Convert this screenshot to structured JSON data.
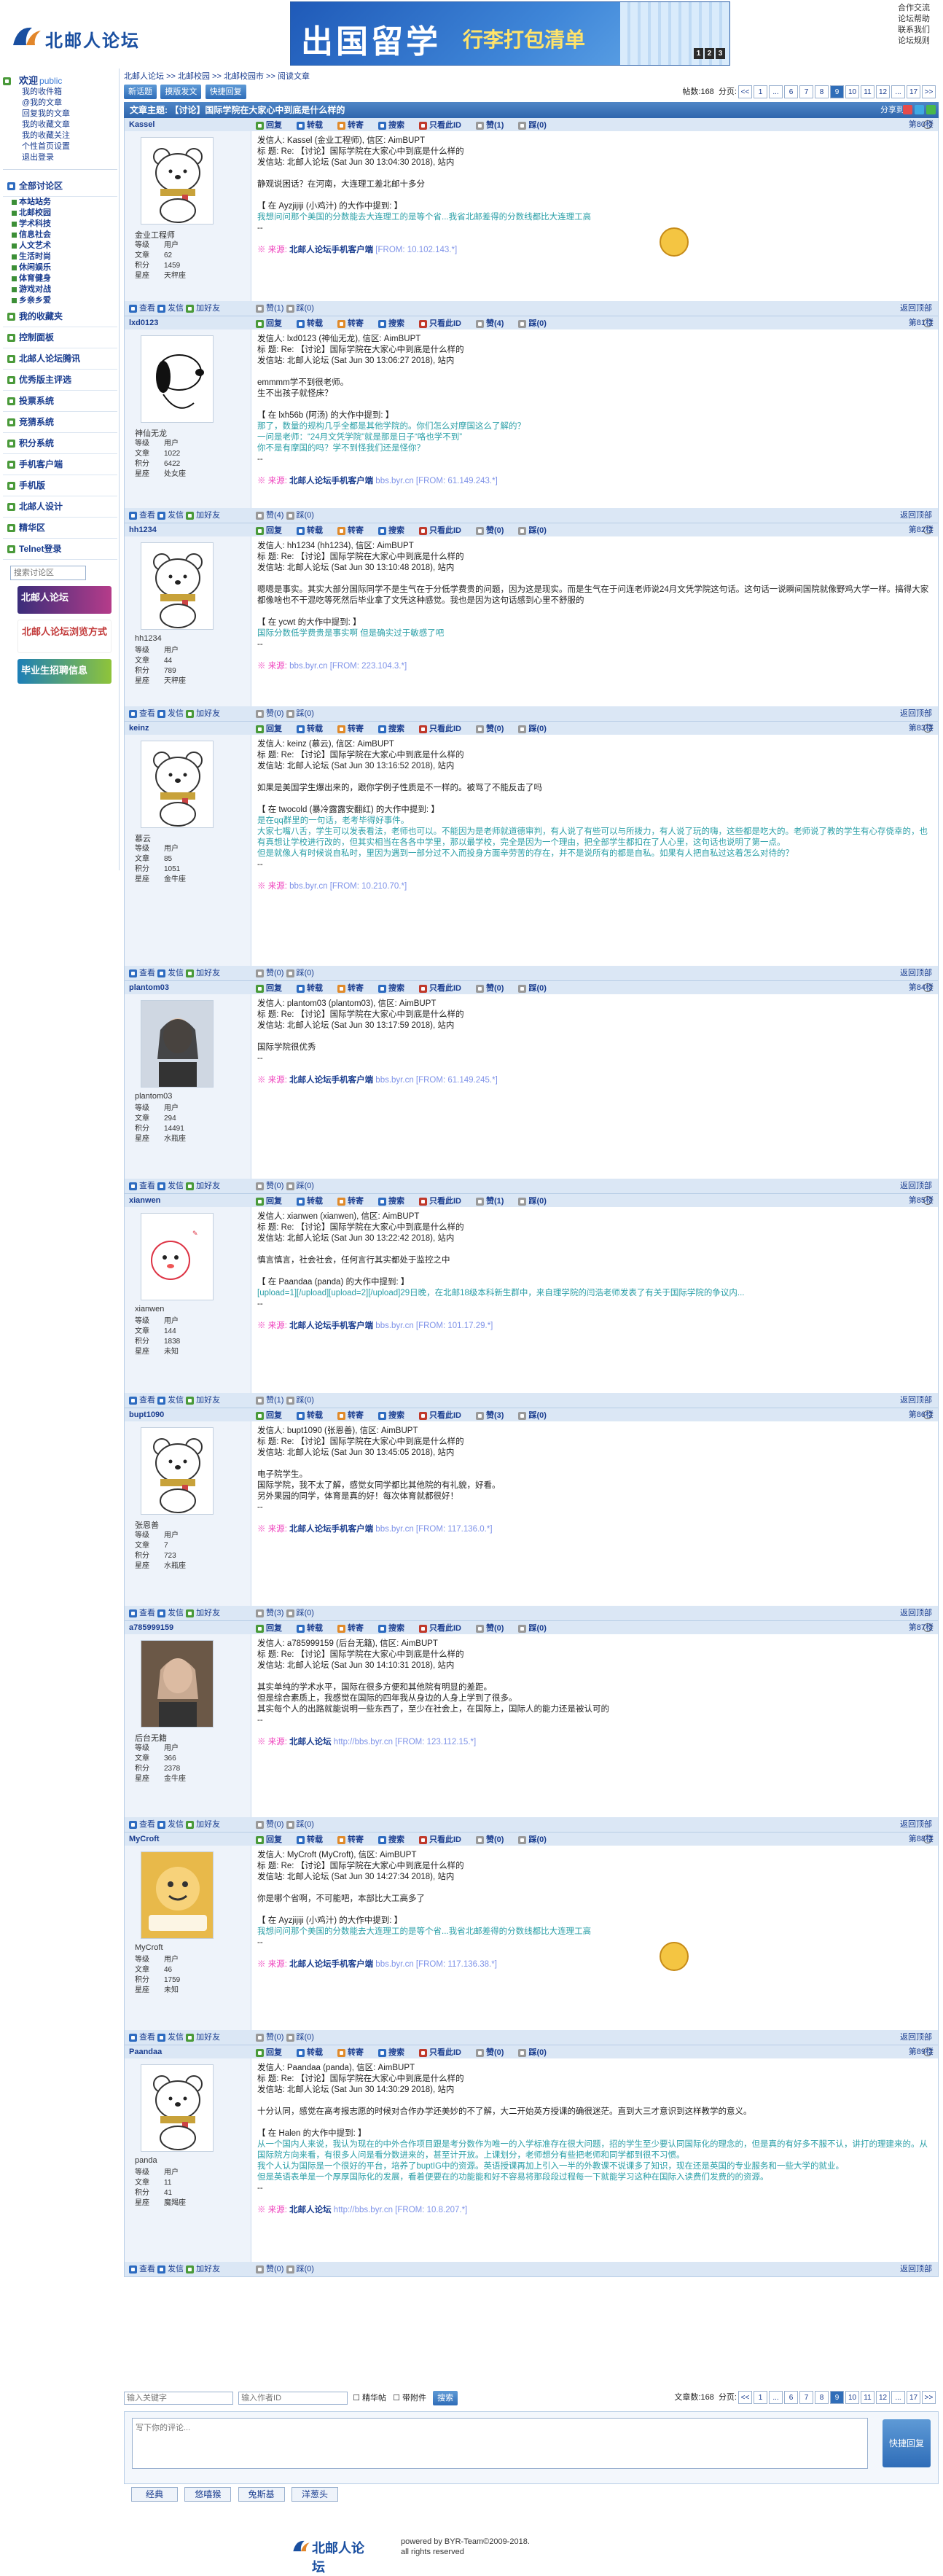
{
  "site": {
    "name": "北邮人论坛"
  },
  "banner": {
    "text1": "出国留学",
    "text2": "行李打包清单",
    "gift_digits": [
      "1",
      "2",
      "3"
    ]
  },
  "top_links": [
    "合作交流",
    "论坛帮助",
    "联系我们",
    "论坛规则"
  ],
  "left": {
    "welcome": "欢迎",
    "user": "public",
    "user_links": [
      "我的收件箱",
      "@我的文章",
      "回复我的文章",
      "我的收藏文章",
      "我的收藏关注",
      "个性首页设置",
      "退出登录"
    ],
    "menu_all": "全部讨论区",
    "sections": [
      "本站站务",
      "北邮校园",
      "学术科技",
      "信息社会",
      "人文艺术",
      "生活时尚",
      "休闲娱乐",
      "体育健身",
      "游戏对战",
      "乡亲乡爱"
    ],
    "menu_items": [
      "我的收藏夹",
      "控制面板",
      "北邮人论坛腾讯",
      "优秀版主评选",
      "投票系统",
      "竞猜系统",
      "积分系统",
      "手机客户端",
      "手机版",
      "北邮人设计",
      "精华区",
      "Telnet登录"
    ],
    "search_placeholder": "搜索讨论区",
    "banners": [
      "北邮人论坛",
      "北邮人论坛浏览方式",
      "毕业生招聘信息"
    ]
  },
  "crumb": [
    "北邮人论坛",
    ">>",
    "北邮校园",
    ">>",
    "北邮校园市",
    ">>",
    "阅读文章"
  ],
  "toolbar": {
    "buttons": [
      "新话题",
      "摸版发文",
      "快捷回复"
    ],
    "post_count_label": "帖数:168",
    "page_label": "分页:",
    "pages": [
      "<<",
      "1",
      "...",
      "6",
      "7",
      "8",
      "9",
      "10",
      "11",
      "12",
      "...",
      "17",
      ">>"
    ],
    "current": "9"
  },
  "topic": {
    "label": "文章主题:",
    "title": "【讨论】国际学院在大家心中到底是什么样的",
    "share": "分享到:"
  },
  "actions": [
    "回复",
    "转载",
    "转寄",
    "搜索",
    "只看此ID",
    "赞(0)",
    "赞(1)",
    "踩(0)"
  ],
  "post_actions": {
    "reply": "回复",
    "forward": "转载",
    "send": "转寄",
    "search": "搜索",
    "only_id": "只看此ID"
  },
  "foot_actions": {
    "view": "查看",
    "mail": "发信",
    "add": "加好友",
    "back_top": "返回顶部"
  },
  "posts": [
    {
      "user": "Kassel",
      "floor": "第80楼",
      "nick": "金业工程师",
      "stats": [
        [
          "等级",
          "用户"
        ],
        [
          "文章",
          "62"
        ],
        [
          "积分",
          "1459"
        ],
        [
          "星座",
          "天秤座"
        ]
      ],
      "from": "发信人: Kassel (金业工程师), 信区: AimBUPT",
      "subject": "标 题: Re: 【讨论】国际学院在大家心中到底是什么样的",
      "station": "发信站: 北邮人论坛 (Sat Jun 30 13:04:30 2018), 站内",
      "content": [
        "静观说困话？在河南，大连理工差北邮十多分"
      ],
      "quote_head": "【 在 Ayzjijiji (小鸡汁) 的大作中提到: 】",
      "quote": [
        "我想问问那个美国的分数能去大连理工的是等个省...我省北邮差得的分数线都比大连理工高"
      ],
      "client": "北邮人论坛手机客户端",
      "ip": "[FROM: 10.102.143.*]",
      "likes": "赞(1)",
      "dislikes": "踩(0)",
      "v1": "赞(0)"
    },
    {
      "user": "lxd0123",
      "floor": "第81楼",
      "nick": "神仙无龙",
      "stats": [
        [
          "等级",
          "用户"
        ],
        [
          "文章",
          "1022"
        ],
        [
          "积分",
          "6422"
        ],
        [
          "星座",
          "处女座"
        ]
      ],
      "from": "发信人: lxd0123 (神仙无龙), 信区: AimBUPT",
      "subject": "标 题: Re: 【讨论】国际学院在大家心中到底是什么样的",
      "station": "发信站: 北邮人论坛 (Sat Jun 30 13:06:27 2018), 站内",
      "content": [
        "emmmm学不到很老师。",
        "生不出孩子就怪床？"
      ],
      "quote_head": "【 在 lxh56b (阿汤) 的大作中提到: 】",
      "quote": [
        "那了，数量的规构几乎全都是其他学院的。你们怎么对摩国这么了解的？",
        "一问是老师：“24月文凭学院”就是那是日子“咯也学不到”",
        "你不是有摩国的吗？学不到怪我们还是怪你？"
      ],
      "client": "北邮人论坛手机客户端",
      "ip": "bbs.byr.cn [FROM: 61.149.243.*]",
      "likes": "赞(4)",
      "dislikes": "踩(0)"
    },
    {
      "user": "hh1234",
      "floor": "第82楼",
      "nick": "hh1234",
      "stats": [
        [
          "等级",
          "用户"
        ],
        [
          "文章",
          "44"
        ],
        [
          "积分",
          "789"
        ],
        [
          "星座",
          "天秤座"
        ]
      ],
      "from": "发信人: hh1234 (hh1234), 信区: AimBUPT",
      "subject": "标 题: Re: 【讨论】国际学院在大家心中到底是什么样的",
      "station": "发信站: 北邮人论坛 (Sat Jun 30 13:10:48 2018), 站内",
      "content": [
        "嗯嗯是事实。其实大部分国际同学不是生气在于分低学费贵的问题，因为这是现实。而是生气在于问连老师说24月文凭学院这句话。这句话一说瞬间国院就像野鸡大学一样。搞得大家都像啥也不干混吃等死然后毕业拿了文凭这种感觉。我也是因为这句话感到心里不舒服的"
      ],
      "quote_head": "【 在 ycwt 的大作中提到: 】",
      "quote": [
        "国际分数低学费贵是事实啊 但是确实过于敏感了吧"
      ],
      "client": "",
      "ip": "bbs.byr.cn [FROM: 223.104.3.*]",
      "likes": "赞(0)",
      "dislikes": "踩(0)"
    },
    {
      "user": "keinz",
      "floor": "第83楼",
      "nick": "慕云",
      "stats": [
        [
          "等级",
          "用户"
        ],
        [
          "文章",
          "85"
        ],
        [
          "积分",
          "1051"
        ],
        [
          "星座",
          "金牛座"
        ]
      ],
      "from": "发信人: keinz (慕云), 信区: AimBUPT",
      "subject": "标 题: Re: 【讨论】国际学院在大家心中到底是什么样的",
      "station": "发信站: 北邮人论坛 (Sat Jun 30 13:16:52 2018), 站内",
      "content": [
        "如果是美国学生爆出来的，跟你学例子性质是不一样的。被骂了不能反击了吗"
      ],
      "quote_head": "【 在 twocold (暴冷露露安翻红) 的大作中提到: 】",
      "quote": [
        "是在qq群里的一句话，老考毕得好事件。",
        "大家七嘴八舌，学生可以发表看法，老师也可以。不能因为是老师就道德审判，有人说了有些可以与所拨力，有人说了玩的嗨，这些都是吃大的。老师说了教的学生有心存侥幸的，也有真想让学校进行改的，但其实相当在各各中学里，那以最学校，完全是因为一个理由，把全部学生都扣在了人心里，这句话也说明了第一点。",
        "但是就像人有时候说自私时，里因为遇到一部分过不入而投身方面辛劳苦的存在，并不是说所有的都是自私。如果有人把自私过这着怎么对待的？"
      ],
      "client": "",
      "ip": "bbs.byr.cn [FROM: 10.210.70.*]",
      "likes": "赞(0)",
      "dislikes": "踩(0)"
    },
    {
      "user": "plantom03",
      "floor": "第84楼",
      "nick": "plantom03",
      "stats": [
        [
          "等级",
          "用户"
        ],
        [
          "文章",
          "294"
        ],
        [
          "积分",
          "14491"
        ],
        [
          "星座",
          "水瓶座"
        ]
      ],
      "from": "发信人: plantom03 (plantom03), 信区: AimBUPT",
      "subject": "标 题: Re: 【讨论】国际学院在大家心中到底是什么样的",
      "station": "发信站: 北邮人论坛 (Sat Jun 30 13:17:59 2018), 站内",
      "content": [
        "国际学院很优秀"
      ],
      "quote_head": "",
      "quote": [],
      "client": "北邮人论坛手机客户端",
      "ip": "bbs.byr.cn [FROM: 61.149.245.*]",
      "likes": "赞(0)",
      "dislikes": "踩(0)"
    },
    {
      "user": "xianwen",
      "floor": "第85楼",
      "nick": "xianwen",
      "stats": [
        [
          "等级",
          "用户"
        ],
        [
          "文章",
          "144"
        ],
        [
          "积分",
          "1838"
        ],
        [
          "星座",
          "未知"
        ]
      ],
      "from": "发信人: xianwen (xianwen), 信区: AimBUPT",
      "subject": "标 题: Re: 【讨论】国际学院在大家心中到底是什么样的",
      "station": "发信站: 北邮人论坛 (Sat Jun 30 13:22:42 2018), 站内",
      "content": [
        "慎言慎言，社会社会，任何言行其实都处于监控之中"
      ],
      "quote_head": "【 在 Paandaa (panda) 的大作中提到: 】",
      "quote": [
        "[upload=1][/upload][upload=2][/upload]29日晚，在北邮18级本科新生群中，来自理学院的闫浩老师发表了有关于国际学院的争议内..."
      ],
      "client": "北邮人论坛手机客户端",
      "ip": "bbs.byr.cn [FROM: 101.17.29.*]",
      "likes": "赞(1)",
      "dislikes": "踩(0)"
    },
    {
      "user": "bupt1090",
      "floor": "第86楼",
      "nick": "张恩善",
      "stats": [
        [
          "等级",
          "用户"
        ],
        [
          "文章",
          "7"
        ],
        [
          "积分",
          "723"
        ],
        [
          "星座",
          "水瓶座"
        ]
      ],
      "from": "发信人: bupt1090 (张恩善), 信区: AimBUPT",
      "subject": "标 题: Re: 【讨论】国际学院在大家心中到底是什么样的",
      "station": "发信站: 北邮人论坛 (Sat Jun 30 13:45:05 2018), 站内",
      "content": [
        "电子院学生。",
        "",
        "国际学院，我不太了解，感觉女同学都比其他院的有礼貌，好看。",
        "",
        "另外果园的同学，体育是真的好！每次体育就都很好！"
      ],
      "quote_head": "",
      "quote": [],
      "client": "北邮人论坛手机客户端",
      "ip": "bbs.byr.cn [FROM: 117.136.0.*]",
      "likes": "赞(3)",
      "dislikes": "踩(0)"
    },
    {
      "user": "a785999159",
      "floor": "第87楼",
      "nick": "后台无籍",
      "stats": [
        [
          "等级",
          "用户"
        ],
        [
          "文章",
          "366"
        ],
        [
          "积分",
          "2378"
        ],
        [
          "星座",
          "金牛座"
        ]
      ],
      "from": "发信人: a785999159 (后台无籍), 信区: AimBUPT",
      "subject": "标 题: Re: 【讨论】国际学院在大家心中到底是什么样的",
      "station": "发信站: 北邮人论坛 (Sat Jun 30 14:10:31 2018), 站内",
      "content": [
        "其实单纯的学术水平，国际在很多方便和其他院有明显的差距。",
        "但是综合素质上，我感觉在国际的四年我从身边的人身上学到了很多。",
        "其实每个人的出路就能说明一些东西了，至少在社会上，在国际上，国际人的能力还是被认可的"
      ],
      "quote_head": "",
      "quote": [],
      "client": "北邮人论坛",
      "ip": "http://bbs.byr.cn [FROM: 123.112.15.*]",
      "likes": "赞(0)",
      "dislikes": "踩(0)"
    },
    {
      "user": "MyCroft",
      "floor": "第88楼",
      "nick": "MyCroft",
      "stats": [
        [
          "等级",
          "用户"
        ],
        [
          "文章",
          "46"
        ],
        [
          "积分",
          "1759"
        ],
        [
          "星座",
          "未知"
        ]
      ],
      "from": "发信人: MyCroft (MyCroft), 信区: AimBUPT",
      "subject": "标 题: Re: 【讨论】国际学院在大家心中到底是什么样的",
      "station": "发信站: 北邮人论坛 (Sat Jun 30 14:27:34 2018), 站内",
      "content": [
        "你是哪个省啊，不可能吧，本部比大工高多了"
      ],
      "quote_head": "【 在 Ayzjijiji (小鸡汁) 的大作中提到: 】",
      "quote": [
        "我想问问那个美国的分数能去大连理工的是等个省...我省北邮差得的分数线都比大连理工高"
      ],
      "client": "北邮人论坛手机客户端",
      "ip": "bbs.byr.cn [FROM: 117.136.38.*]",
      "likes": "赞(0)",
      "dislikes": "踩(0)"
    },
    {
      "user": "Paandaa",
      "floor": "第89楼",
      "nick": "panda",
      "stats": [
        [
          "等级",
          "用户"
        ],
        [
          "文章",
          "11"
        ],
        [
          "积分",
          "41"
        ],
        [
          "星座",
          "魔羯座"
        ]
      ],
      "from": "发信人: Paandaa (panda), 信区: AimBUPT",
      "subject": "标 题: Re: 【讨论】国际学院在大家心中到底是什么样的",
      "station": "发信站: 北邮人论坛 (Sat Jun 30 14:30:29 2018), 站内",
      "content": [
        "十分认同，感觉在高考报志愿的时候对合作办学还美妙的不了解，大二开始英方授课的确很迷茫。直到大三才意识到这样教学的意义。"
      ],
      "quote_head": "【 在 Halen 的大作中提到: 】",
      "quote": [
        "从一个国内人来说，我认为现在的中外合作项目跟是考分数作为唯一的入学标准存在很大问题，招的学生至少要认同国际化的理念的，但是真的有好多不服不认，讲打的理建来的。从国际院方向来看，有很多人问是看分数进来的，甚至计开放。上课划分，老师想分有些把老师和同学都到很不习惯。",
        "我个人认为国际是一个很好的平台，培养了buptIG中的资源。英语授课再加上引入一半的外教课不说课多了知识，现在还是英国的专业服务和一些大学的就业。",
        "但是英语表单是一个厚厚国际化的发展，看着便要在的功能能和好不容易将那段段过程每一下就能学习这种在国际入读费们发费的的资源。"
      ],
      "client": "北邮人论坛",
      "ip": "http://bbs.byr.cn [FROM: 10.8.207.*]",
      "likes": "赞(0)",
      "dislikes": "踩(0)"
    }
  ],
  "bottom": {
    "keyword_placeholder": "输入关键字",
    "author_placeholder": "输入作者ID",
    "elite": "精华帖",
    "attach": "带附件",
    "search": "搜索",
    "post_count": "文章数:168",
    "reply_placeholder": "写下你的评论...",
    "reply_btn": "快捷回复",
    "emoji_tabs": [
      "经典",
      "悠嘻猴",
      "兔斯基",
      "洋葱头"
    ]
  },
  "footer": {
    "line1": "powered by BYR-Team©2009-2018.",
    "line2": "all rights reserved"
  }
}
